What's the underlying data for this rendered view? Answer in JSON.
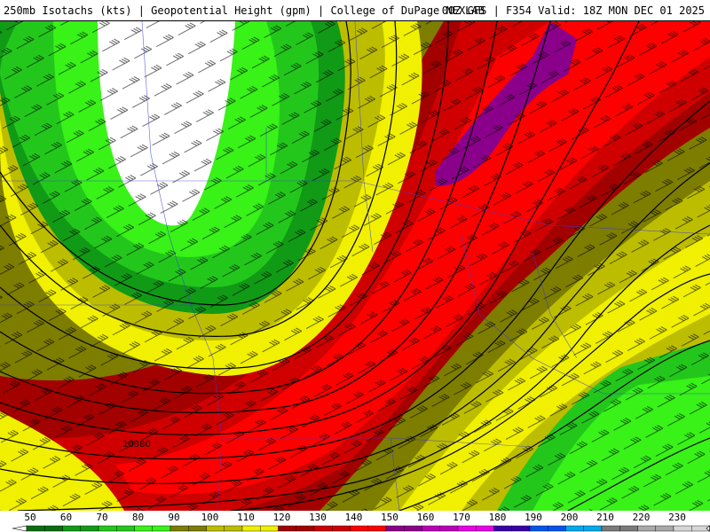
{
  "header": {
    "title_left": "250mb Isotachs (kts) | Geopotential Height (gpm) | College of DuPage NEXLAB",
    "title_right": "00Z GFS | F354 Valid: 18Z MON DEC 01 2025"
  },
  "map": {
    "contour_label": "10380",
    "fill_colors": {
      "lt50": "#ffffff",
      "k50": "#0a6e10",
      "k60": "#119a16",
      "k70": "#23c71c",
      "k80": "#38f218",
      "k90": "#7d7d00",
      "k100": "#bdbd00",
      "k110": "#f0f000",
      "k120": "#a30000",
      "k130": "#d00000",
      "k140": "#ff0000",
      "k150": "#8a008a"
    }
  },
  "legend": {
    "ticks": [
      "50",
      "60",
      "70",
      "80",
      "90",
      "100",
      "110",
      "120",
      "130",
      "140",
      "150",
      "160",
      "170",
      "180",
      "190",
      "200",
      "210",
      "220",
      "230"
    ],
    "colors": [
      "#0a6e10",
      "#119a16",
      "#23c71c",
      "#38f218",
      "#7d7d00",
      "#bdbd00",
      "#f0f000",
      "#a30000",
      "#d00000",
      "#ff0000",
      "#8a008a",
      "#bb00bb",
      "#ea00ea",
      "#3a00aa",
      "#0055ee",
      "#00aaee",
      "#7a7a7a",
      "#a9a9a9",
      "#d6d6d6"
    ]
  }
}
